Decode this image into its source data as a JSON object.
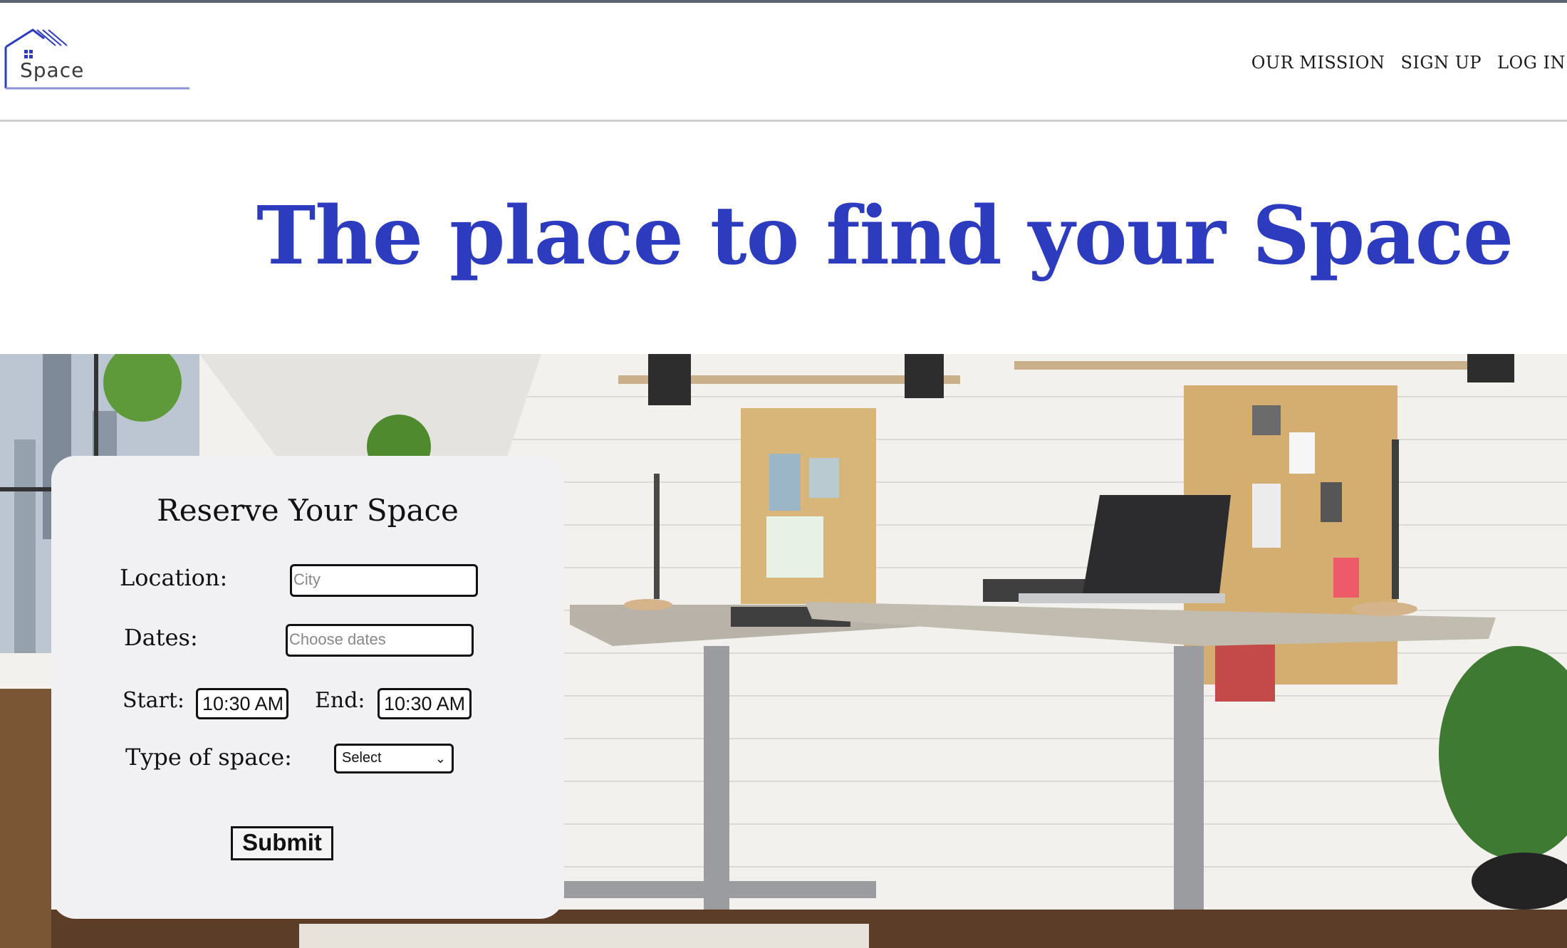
{
  "brand": {
    "logo_text": "Space",
    "accent": "#2d3bbf"
  },
  "nav": {
    "items": [
      "OUR MISSION",
      "SIGN UP",
      "LOG IN"
    ]
  },
  "hero": {
    "title": "The place to find your Space"
  },
  "form": {
    "title": "Reserve Your Space",
    "location_label": "Location:",
    "location_placeholder": "City",
    "dates_label": "Dates:",
    "dates_placeholder": "Choose dates",
    "start_label": "Start:",
    "start_value": "10:30 AM",
    "end_label": "End:",
    "end_value": "10:30 AM",
    "type_label": "Type of space:",
    "type_selected": "Select",
    "submit_label": "Submit"
  },
  "icons": [
    "house-logo-icon",
    "chevron-down-icon"
  ]
}
